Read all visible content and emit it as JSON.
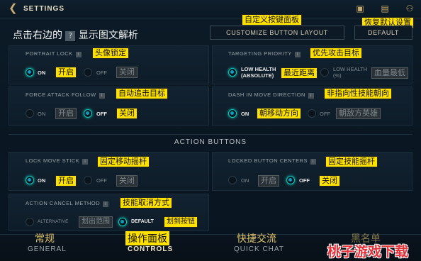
{
  "header": {
    "back_icon": "back-chevron-icon",
    "title": "SETTINGS",
    "icons": [
      "bag-icon",
      "chat-icon",
      "friends-icon"
    ]
  },
  "page_hint": {
    "prefix": "点击右边的",
    "icon": "?",
    "suffix": "显示图文解析"
  },
  "customize": {
    "label": "CUSTOMIZE BUTTON LAYOUT",
    "annotation": "自定义按键面板"
  },
  "default_btn": {
    "label": "DEFAULT",
    "annotation": "恢复默认设置"
  },
  "portrait_lock": {
    "label": "PORTRAIT LOCK",
    "annotation": "头像锁定",
    "on": "ON",
    "on_cn": "开启",
    "off": "OFF",
    "off_cn": "关闭",
    "selected": "on"
  },
  "targeting": {
    "label": "TARGETING PRIORITY",
    "annotation": "优先攻击目标",
    "opt1_line1": "LOW HEALTH",
    "opt1_line2": "(ABSOLUTE)",
    "opt1_cn": "最近距离",
    "opt2_line1": "LOW HEALTH",
    "opt2_line2": "(%)",
    "opt2_cn": "血量最低",
    "selected": "opt1"
  },
  "force_attack": {
    "label": "FORCE ATTACK FOLLOW",
    "annotation": "自动追击目标",
    "on": "ON",
    "on_cn": "开启",
    "off": "OFF",
    "off_cn": "关闭",
    "selected": "off"
  },
  "dash_move": {
    "label": "DASH IN MOVE DIRECTION",
    "annotation": "非指向性技能朝向",
    "on": "ON",
    "on_cn": "朝移动方向",
    "off": "OFF",
    "off_cn": "朝敌方英雄",
    "selected": "on"
  },
  "section_title": "ACTION BUTTONS",
  "lock_move": {
    "label": "LOCK MOVE STICK",
    "annotation": "固定移动摇杆",
    "on": "ON",
    "on_cn": "开启",
    "off": "OFF",
    "off_cn": "关闭",
    "selected": "on"
  },
  "locked_button": {
    "label": "LOCKED BUTTON CENTERS",
    "annotation": "固定技能摇杆",
    "on": "ON",
    "on_cn": "开启",
    "off": "OFF",
    "off_cn": "关闭",
    "selected": "off"
  },
  "action_cancel": {
    "label": "ACTION CANCEL METHOD",
    "annotation": "技能取消方式",
    "opt1": "ALTERNATIVE",
    "opt1_cn": "划出范围",
    "opt2": "DEFAULT",
    "opt2_cn": "划到按钮",
    "selected": "opt2"
  },
  "nav": {
    "general": "GENERAL",
    "general_cn": "常规",
    "controls": "CONTROLS",
    "controls_cn": "操作面板",
    "quickchat": "QUICK CHAT",
    "quickchat_cn": "快捷交流",
    "blocklist_cn": "黑名单",
    "active": "controls"
  },
  "watermark": "桃子游戏下载",
  "colors": {
    "accent": "#0ac8b9",
    "gold": "#c8aa6e",
    "annotation": "#ffe100"
  }
}
